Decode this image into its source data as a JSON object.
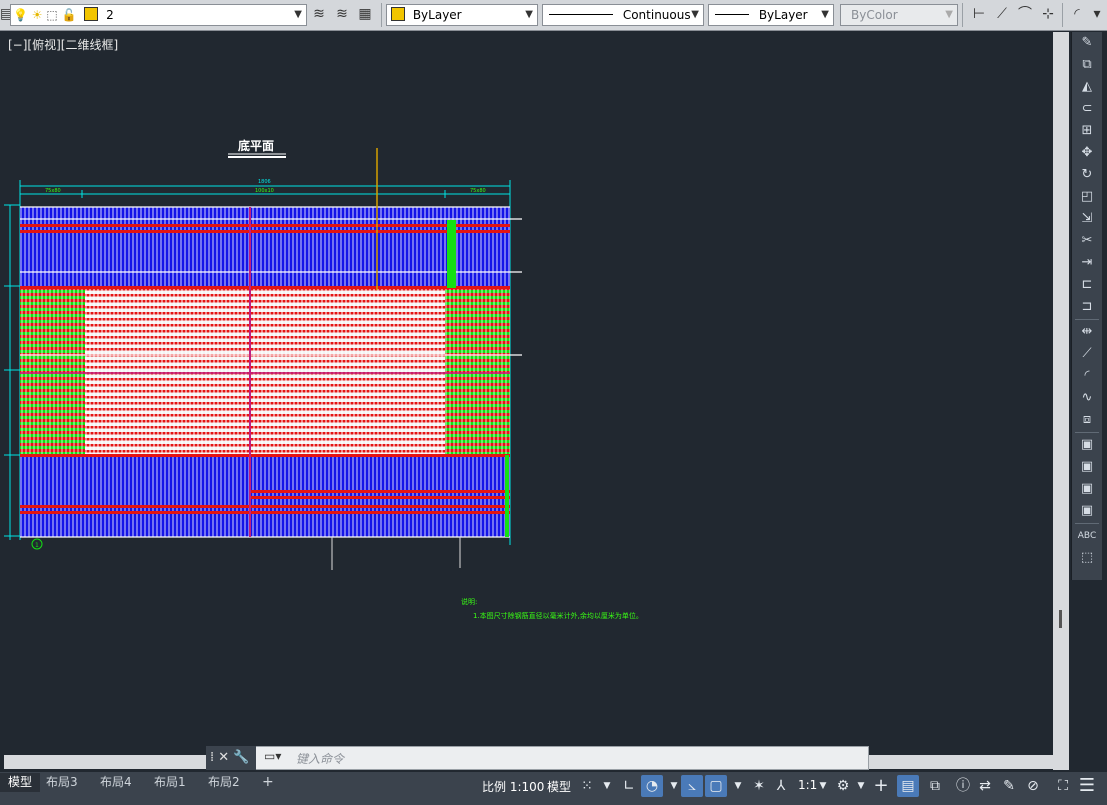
{
  "toolbar": {
    "layer_name": "2",
    "color_value": "ByLayer",
    "linetype_value": "Continuous",
    "lineweight_value": "ByLayer",
    "plotstyle_value": "ByColor"
  },
  "viewport": {
    "view_label": "[−][俯视][二维线框]"
  },
  "drawing": {
    "title": "底平面",
    "notes_heading": "说明:",
    "notes_line1": "1.本图尺寸除钢筋直径以毫米计外,余均以厘米为单位。",
    "dim_total": "1806",
    "dim_left": "75x80",
    "dim_mid": "100x10",
    "dim_right": "75x80",
    "axis_marker": "1"
  },
  "command": {
    "placeholder": "键入命令"
  },
  "layout_tabs": [
    {
      "label": "模型",
      "active": true
    },
    {
      "label": "布局3",
      "active": false
    },
    {
      "label": "布局4",
      "active": false
    },
    {
      "label": "布局1",
      "active": false
    },
    {
      "label": "布局2",
      "active": false
    }
  ],
  "status": {
    "add_tab": "+",
    "scale_label": "比例 1:100",
    "model_label": "模型",
    "annot_scale": "1:1"
  },
  "colors": {
    "rebar_blue": "#1010e0",
    "rebar_red": "#e01010",
    "rebar_green": "#10e010",
    "dim_cyan": "#00e5e5",
    "background": "#212830"
  }
}
